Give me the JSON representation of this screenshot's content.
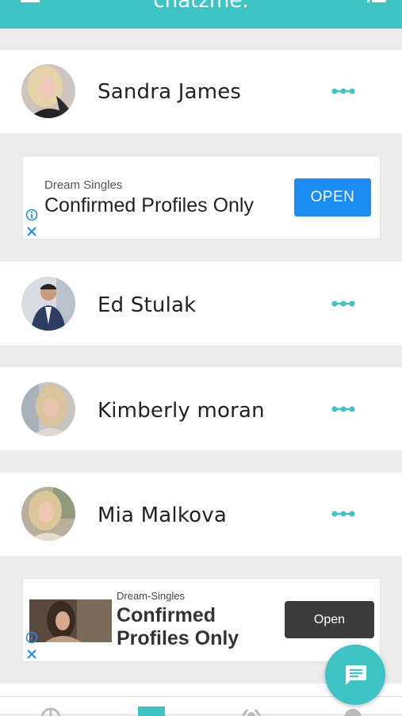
{
  "header": {
    "title": "chatzme."
  },
  "contacts": [
    {
      "name": "Sandra James",
      "avatar": "avatar-blonde-woman"
    },
    {
      "name": "Ed Stulak",
      "avatar": "avatar-man-suit"
    },
    {
      "name": "Kimberly moran",
      "avatar": "avatar-blonde-woman-car"
    },
    {
      "name": "Mia Malkova",
      "avatar": "avatar-blonde-woman-outdoor"
    }
  ],
  "ads": [
    {
      "advertiser": "Dream Singles",
      "headline": "Confirmed Profiles Only",
      "button": "OPEN"
    },
    {
      "advertiser": "Dream-Singles",
      "headline": "Confirmed Profiles Only",
      "button": "Open"
    }
  ],
  "icons": {
    "menu": "menu-icon",
    "list": "list-icon",
    "more": "more-dots-icon",
    "fab": "chat-bubble-icon",
    "adchoices": "info-icon",
    "close": "close-icon"
  },
  "colors": {
    "accent": "#3fc4c6",
    "ad_button_primary": "#1a8cf2",
    "ad_button_dark": "#3b3b3b"
  }
}
